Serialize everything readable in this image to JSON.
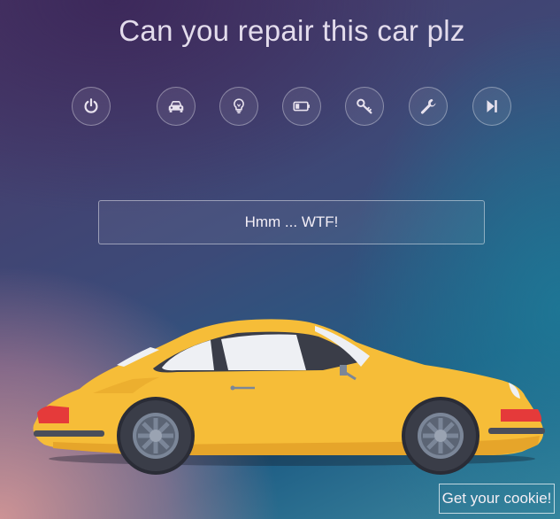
{
  "title": "Can you repair this car plz",
  "toolbar": {
    "buttons": [
      {
        "icon": "power-icon"
      },
      {
        "icon": "car-icon"
      },
      {
        "icon": "lightbulb-icon"
      },
      {
        "icon": "battery-icon"
      },
      {
        "icon": "key-icon"
      },
      {
        "icon": "wrench-icon"
      },
      {
        "icon": "skip-forward-icon"
      }
    ]
  },
  "message": "Hmm ... WTF!",
  "cookie_button": "Get your cookie!",
  "colors": {
    "car_body": "#f6bd38",
    "car_shadow": "#e6a52a",
    "tire": "#3a3d48",
    "rim": "#7b8698",
    "tail_light": "#e53a3a",
    "window": "#eef0f4",
    "icon": "#e8e2ee"
  }
}
